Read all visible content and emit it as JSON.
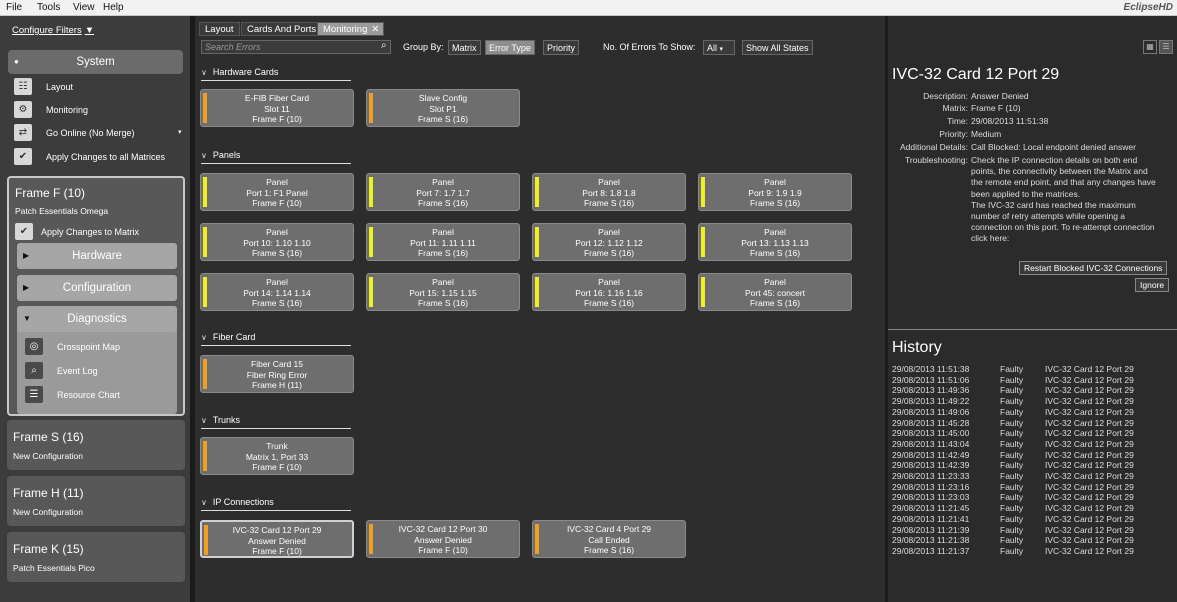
{
  "menu": {
    "items": [
      "File",
      "Tools",
      "View",
      "Help"
    ],
    "brand": "EclipseHD"
  },
  "sidebar": {
    "configure_filters": "Configure Filters",
    "system": {
      "title": "System",
      "items": [
        "Layout",
        "Monitoring",
        "Go Online (No Merge)",
        "Apply Changes to all Matrices"
      ]
    },
    "frames": [
      {
        "title": "Frame F (10)",
        "subtitle": "Patch Essentials Omega",
        "apply": "Apply Changes to Matrix",
        "hardware": "Hardware",
        "configuration": "Configuration",
        "diagnostics": "Diagnostics",
        "diag_items": [
          "Crosspoint Map",
          "Event Log",
          "Resource Chart"
        ]
      },
      {
        "title": "Frame S (16)",
        "subtitle": "New Configuration"
      },
      {
        "title": "Frame H (11)",
        "subtitle": "New Configuration"
      },
      {
        "title": "Frame K (15)",
        "subtitle": "Patch Essentials Pico"
      }
    ]
  },
  "tabs": [
    "Layout",
    "Cards And Ports",
    "Monitoring"
  ],
  "toolbar": {
    "search_placeholder": "Search Errors",
    "group_by": "Group By:",
    "group_options": [
      "Matrix",
      "Error Type",
      "Priority"
    ],
    "errors_label": "No. Of Errors To Show:",
    "errors_value": "All",
    "show_all": "Show All States"
  },
  "sections": [
    {
      "title": "Hardware Cards",
      "cards": [
        {
          "lines": [
            "E-FIB Fiber Card",
            "Slot 11",
            "Frame F (10)"
          ],
          "color": "#f0a020"
        },
        {
          "lines": [
            "Slave Config",
            "Slot P1",
            "Frame S (16)"
          ],
          "color": "#f0a020"
        }
      ]
    },
    {
      "title": "Panels",
      "cards": [
        {
          "lines": [
            "Panel",
            "Port 1: F1 Panel",
            "Frame F (10)"
          ],
          "color": "#f0f020"
        },
        {
          "lines": [
            "Panel",
            "Port 7: 1.7  1.7",
            "Frame S (16)"
          ],
          "color": "#f0f020"
        },
        {
          "lines": [
            "Panel",
            "Port 8: 1.8  1.8",
            "Frame S (16)"
          ],
          "color": "#f0f020"
        },
        {
          "lines": [
            "Panel",
            "Port 9: 1.9  1.9",
            "Frame S (16)"
          ],
          "color": "#f0f020"
        },
        {
          "lines": [
            "Panel",
            "Port 10: 1.10 1.10",
            "Frame S (16)"
          ],
          "color": "#f0f020"
        },
        {
          "lines": [
            "Panel",
            "Port 11: 1.11 1.11",
            "Frame S (16)"
          ],
          "color": "#f0f020"
        },
        {
          "lines": [
            "Panel",
            "Port 12: 1.12 1.12",
            "Frame S (16)"
          ],
          "color": "#f0f020"
        },
        {
          "lines": [
            "Panel",
            "Port 13: 1.13 1.13",
            "Frame S (16)"
          ],
          "color": "#f0f020"
        },
        {
          "lines": [
            "Panel",
            "Port 14: 1.14 1.14",
            "Frame S (16)"
          ],
          "color": "#f0f020"
        },
        {
          "lines": [
            "Panel",
            "Port 15: 1.15 1.15",
            "Frame S (16)"
          ],
          "color": "#f0f020"
        },
        {
          "lines": [
            "Panel",
            "Port 16: 1.16 1.16",
            "Frame S (16)"
          ],
          "color": "#f0f020"
        },
        {
          "lines": [
            "Panel",
            "Port 45: concert",
            "Frame S (16)"
          ],
          "color": "#f0f020"
        }
      ]
    },
    {
      "title": "Fiber Card",
      "cards": [
        {
          "lines": [
            "Fiber Card 15",
            "Fiber Ring Error",
            "Frame H (11)"
          ],
          "color": "#f0a020"
        }
      ]
    },
    {
      "title": "Trunks",
      "cards": [
        {
          "lines": [
            "Trunk",
            "Matrix 1, Port 33",
            "Frame F (10)"
          ],
          "color": "#f0a020"
        }
      ]
    },
    {
      "title": "IP Connections",
      "cards": [
        {
          "lines": [
            "IVC-32 Card 12 Port 29",
            "Answer Denied",
            "Frame F (10)"
          ],
          "color": "#f0a020"
        },
        {
          "lines": [
            "IVC-32 Card 12 Port 30",
            "Answer Denied",
            "Frame F (10)"
          ],
          "color": "#f0a020"
        },
        {
          "lines": [
            "IVC-32 Card 4 Port 29",
            "Call Ended",
            "Frame S (16)"
          ],
          "color": "#f0a020"
        }
      ]
    }
  ],
  "detail": {
    "title": "IVC-32 Card 12 Port 29",
    "description_label": "Description:",
    "description": "Answer Denied",
    "matrix_label": "Matrix:",
    "matrix": "Frame F (10)",
    "time_label": "Time:",
    "time": "29/08/2013 11:51:38",
    "priority_label": "Priority:",
    "priority": "Medium",
    "additional_label": "Additional Details:",
    "additional": "Call Blocked: Local endpoint denied answer",
    "troubleshooting_label": "Troubleshooting:",
    "troubleshooting_lines": [
      "Check the IP connection details on both end",
      "points, the connectivity between the Matrix and",
      "the remote end point, and that any changes have",
      "been applied to the matrices.",
      "The IVC-32 card has reached the maximum",
      "number of retry attempts while opening a",
      "connection on this port. To re-attempt connection",
      "click here:"
    ],
    "restart_button": "Restart Blocked IVC-32 Connections",
    "ignore_button": "Ignore"
  },
  "history": {
    "title": "History",
    "rows": [
      [
        "29/08/2013 11:51:38",
        "Faulty",
        "IVC-32 Card 12 Port 29"
      ],
      [
        "29/08/2013 11:51:06",
        "Faulty",
        "IVC-32 Card 12 Port 29"
      ],
      [
        "29/08/2013 11:49:36",
        "Faulty",
        "IVC-32 Card 12 Port 29"
      ],
      [
        "29/08/2013 11:49:22",
        "Faulty",
        "IVC-32 Card 12 Port 29"
      ],
      [
        "29/08/2013 11:49:06",
        "Faulty",
        "IVC-32 Card 12 Port 29"
      ],
      [
        "29/08/2013 11:45:28",
        "Faulty",
        "IVC-32 Card 12 Port 29"
      ],
      [
        "29/08/2013 11:45:00",
        "Faulty",
        "IVC-32 Card 12 Port 29"
      ],
      [
        "29/08/2013 11:43:04",
        "Faulty",
        "IVC-32 Card 12 Port 29"
      ],
      [
        "29/08/2013 11:42:49",
        "Faulty",
        "IVC-32 Card 12 Port 29"
      ],
      [
        "29/08/2013 11:42:39",
        "Faulty",
        "IVC-32 Card 12 Port 29"
      ],
      [
        "29/08/2013 11:23:33",
        "Faulty",
        "IVC-32 Card 12 Port 29"
      ],
      [
        "29/08/2013 11:23:16",
        "Faulty",
        "IVC-32 Card 12 Port 29"
      ],
      [
        "29/08/2013 11:23:03",
        "Faulty",
        "IVC-32 Card 12 Port 29"
      ],
      [
        "29/08/2013 11:21:45",
        "Faulty",
        "IVC-32 Card 12 Port 29"
      ],
      [
        "29/08/2013 11:21:41",
        "Faulty",
        "IVC-32 Card 12 Port 29"
      ],
      [
        "29/08/2013 11:21:39",
        "Faulty",
        "IVC-32 Card 12 Port 29"
      ],
      [
        "29/08/2013 11:21:38",
        "Faulty",
        "IVC-32 Card 12 Port 29"
      ],
      [
        "29/08/2013 11:21:37",
        "Faulty",
        "IVC-32 Card 12 Port 29"
      ]
    ]
  }
}
